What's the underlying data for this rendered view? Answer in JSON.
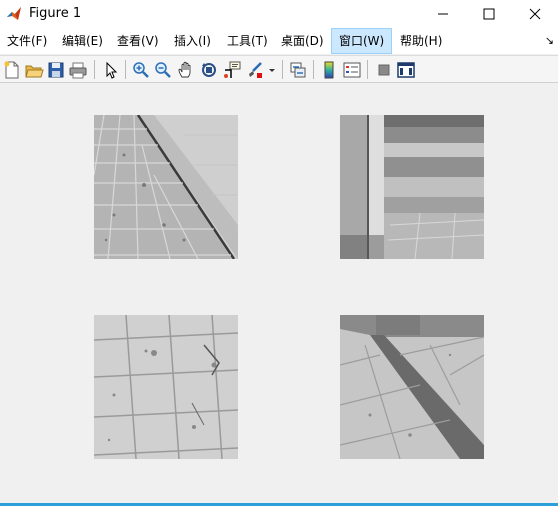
{
  "window": {
    "title": "Figure 1",
    "app_icon": "matlab-logo-icon",
    "controls": [
      "minimize-icon",
      "maximize-icon",
      "close-icon"
    ]
  },
  "menu": {
    "items": [
      {
        "label": "文件(F)"
      },
      {
        "label": "编辑(E)"
      },
      {
        "label": "查看(V)"
      },
      {
        "label": "插入(I)"
      },
      {
        "label": "工具(T)"
      },
      {
        "label": "桌面(D)"
      },
      {
        "label": "窗口(W)",
        "active": true
      },
      {
        "label": "帮助(H)"
      }
    ],
    "expand_glyph": "↘"
  },
  "toolbar": {
    "buttons": [
      "new-figure-icon",
      "open-file-icon",
      "save-icon",
      "print-icon",
      "pointer-icon",
      "zoom-in-icon",
      "zoom-out-icon",
      "pan-hand-icon",
      "rotate-3d-icon",
      "data-cursor-icon",
      "brush-icon",
      "brush-dropdown-icon",
      "link-plot-icon",
      "colorbar-icon",
      "legend-icon",
      "hide-plot-tools-icon",
      "show-plot-tools-icon"
    ]
  },
  "figure": {
    "panels": [
      {
        "name": "image-panel-top-left",
        "content": "pavement-wall-diagonal"
      },
      {
        "name": "image-panel-top-right",
        "content": "stairs-corner"
      },
      {
        "name": "image-panel-bottom-left",
        "content": "paving-tiles"
      },
      {
        "name": "image-panel-bottom-right",
        "content": "curb-triangle-tiles"
      }
    ]
  },
  "colors": {
    "titlebar": "#ffffff",
    "menubar": "#ffffff",
    "menu_active": "#cce8ff",
    "background": "#f0f0f0",
    "accent_line": "#2b9fd8"
  }
}
